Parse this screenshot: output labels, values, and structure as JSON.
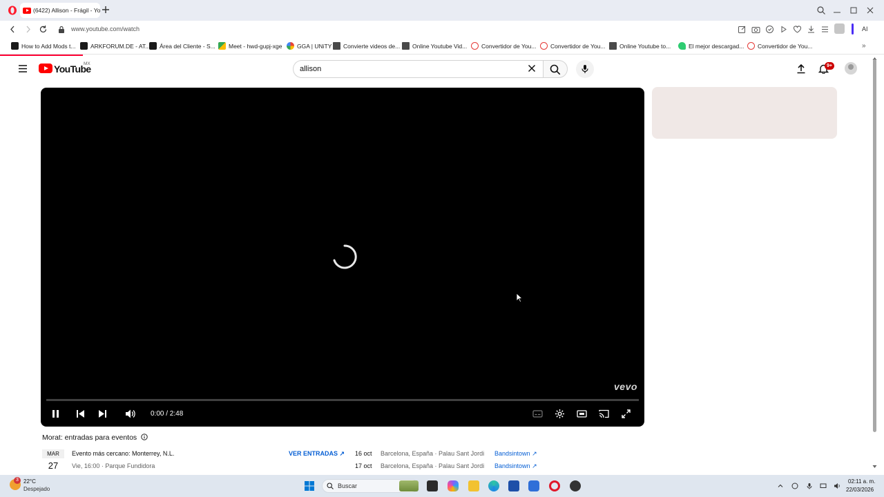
{
  "browser": {
    "tab_title": "(6422) Allison - Frágil - Yo",
    "url": "www.youtube.com/watch",
    "ai_label": "AI",
    "bookmarks": [
      "How to Add Mods t...",
      "ARKFORUM.DE - AT...",
      "Área del Cliente - S...",
      "Meet - hwd-gupj-xge",
      "GGA | UNiTY",
      "Convierte videos de...",
      "Online Youtube Vid...",
      "Convertidor de You...",
      "Convertidor de You...",
      "Online Youtube to...",
      "El mejor descargad...",
      "Convertidor de You..."
    ],
    "bookmarks_more": "»"
  },
  "youtube": {
    "logo_text": "YouTube",
    "country": "MX",
    "search_value": "allison",
    "notification_badge": "9+"
  },
  "player": {
    "time": "0:00 / 2:48",
    "progress": 0.0,
    "watermark": "vevo",
    "state": "loading"
  },
  "events": {
    "title": "Morat: entradas para eventos",
    "month": "MAR",
    "day": "27",
    "nearest": "Evento más cercano: Monterrey, N.L.",
    "nearest_sub": "Vie, 16:00 · Parque Fundidora",
    "cta": "VER ENTRADAS",
    "list": [
      {
        "date": "16 oct",
        "place": "Barcelona, España · Palau Sant Jordi",
        "source": "Bandsintown"
      },
      {
        "date": "17 oct",
        "place": "Barcelona, España · Palau Sant Jordi",
        "source": "Bandsintown"
      }
    ]
  },
  "taskbar": {
    "temperature": "22°C",
    "condition": "Despejado",
    "weather_badge": "3",
    "search_label": "Buscar",
    "time": "02:11 a. m.",
    "date": "22/03/2026"
  },
  "colors": {
    "youtube_red": "#ff0000",
    "link_blue": "#065fd4",
    "side_card": "#f0e8e6"
  }
}
